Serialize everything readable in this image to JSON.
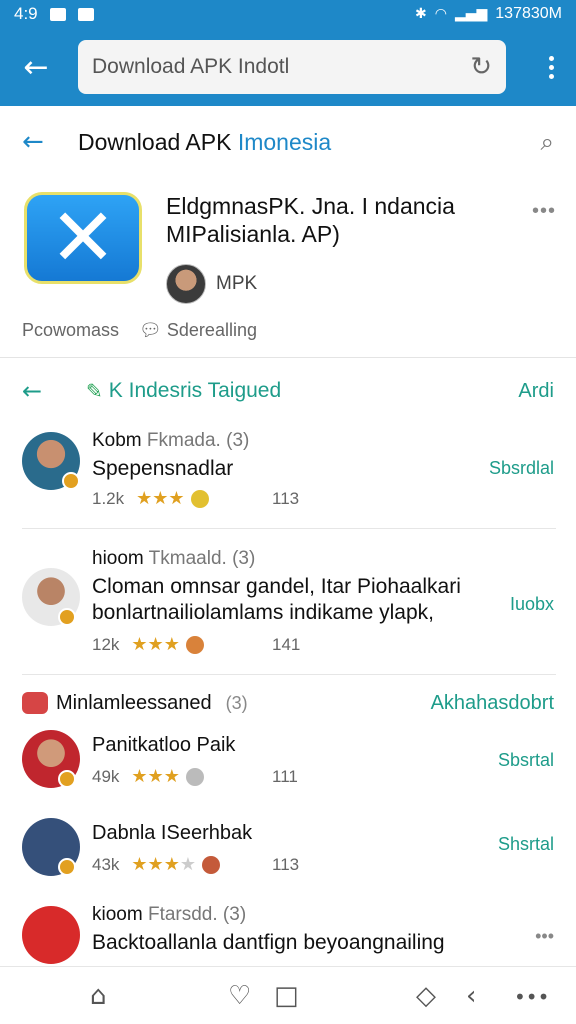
{
  "status_bar": {
    "time": "4:9",
    "right_text": "137830M"
  },
  "browser": {
    "url_text": "Download APK Indotl"
  },
  "page": {
    "title_main": "Download APK ",
    "title_accent": "Imonesia"
  },
  "app": {
    "name": "EldgmnasPK. Jna. I ndancia MIPalisianla. AP)",
    "developer": "MPK",
    "stat_a": "Pcowomass",
    "stat_b": "Sderealling"
  },
  "section1": {
    "title": "K Indesris Taigued",
    "action": "Ardi"
  },
  "reviews": [
    {
      "name": "Kobm",
      "sub": " Fkmada. (3)",
      "text": "Spepensnadlar",
      "count": "1.2k",
      "stars": "★★★",
      "num": "113",
      "action": "Sbsrdlal"
    },
    {
      "name": "hioom",
      "sub": " Tkmaald. (3)",
      "text": "Cloman omnsar gandel, Itar Piohaalkari bonlartnailiolamlams indikame ylapk,",
      "count": "12k",
      "stars": "★★★",
      "num": "141",
      "action": "Iuobx"
    }
  ],
  "section2": {
    "title": "Minlamleessaned",
    "badge": "(3)",
    "action": "Akhahasdobrt"
  },
  "apps": [
    {
      "name": "Panitkatloo Paik",
      "count": "49k",
      "stars": "★★★",
      "num": "111",
      "action": "Sbsrtal"
    },
    {
      "name": "Dabnla ISeerhbak",
      "count": "43k",
      "stars": "★★★",
      "half": "★",
      "num": "113",
      "action": "Shsrtal"
    }
  ],
  "last_review": {
    "name": "kioom",
    "sub": " Ftarsdd. (3)",
    "text": "Backtoallanla dantfign beyoangnailing"
  },
  "colors": {
    "primary": "#1e88c8",
    "accent_green": "#1e9c8a",
    "star": "#e0a020"
  }
}
